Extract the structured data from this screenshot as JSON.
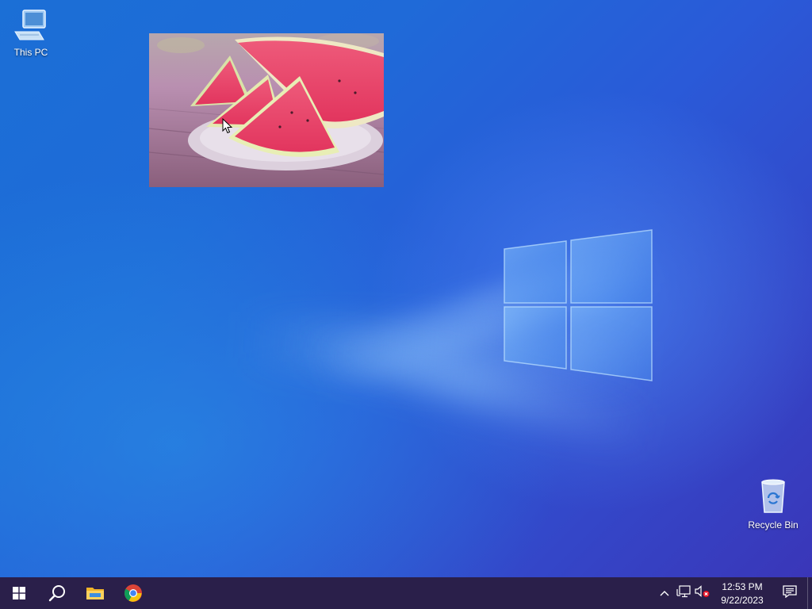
{
  "desktop": {
    "icons": [
      {
        "label": "This PC",
        "icon": "this-pc-icon"
      },
      {
        "label": "Recycle Bin",
        "icon": "recycle-bin-icon"
      }
    ],
    "photo_subject": "watermelon-slices-image"
  },
  "taskbar": {
    "buttons": [
      {
        "icon": "windows-start-icon"
      },
      {
        "icon": "search-icon"
      },
      {
        "icon": "file-explorer-icon"
      },
      {
        "icon": "chrome-icon"
      }
    ],
    "tray": {
      "icons": [
        "chevron-up-icon",
        "network-icon",
        "volume-muted-icon"
      ],
      "time": "12:53 PM",
      "date": "9/22/2023",
      "notification_icon": "action-center-icon"
    },
    "background_color": "#2a1f4a"
  }
}
